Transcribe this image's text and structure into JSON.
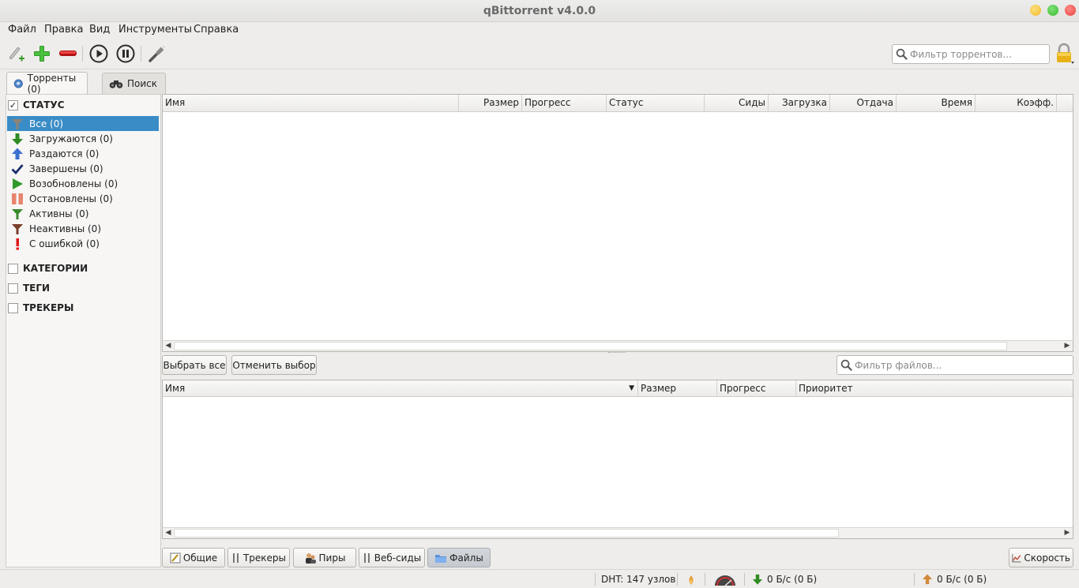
{
  "window": {
    "title": "qBittorrent v4.0.0"
  },
  "menu": [
    "Файл",
    "Правка",
    "Вид",
    "Инструменты",
    "Справка"
  ],
  "toolbar": {
    "icons": [
      "add-link-icon",
      "add-torrent-icon",
      "remove-icon",
      "resume-icon",
      "pause-icon",
      "settings-icon",
      "lock-icon"
    ],
    "search_placeholder": "Фильтр торрентов..."
  },
  "tabs": [
    {
      "label": "Торренты (0)",
      "icon": "torrents-icon",
      "active": true
    },
    {
      "label": "Поиск",
      "icon": "binoculars-icon",
      "active": false
    }
  ],
  "sidebar": {
    "status_title": "СТАТУС",
    "status_checked": true,
    "items": [
      {
        "label": "Все (0)",
        "icon": "filter-icon",
        "selected": true
      },
      {
        "label": "Загружаются (0)",
        "icon": "download-arrow-icon"
      },
      {
        "label": "Раздаются (0)",
        "icon": "upload-arrow-icon"
      },
      {
        "label": "Завершены (0)",
        "icon": "checkmark-icon"
      },
      {
        "label": "Возобновлены (0)",
        "icon": "play-icon"
      },
      {
        "label": "Остановлены (0)",
        "icon": "pause-bars-icon"
      },
      {
        "label": "Активны (0)",
        "icon": "active-filter-icon"
      },
      {
        "label": "Неактивны (0)",
        "icon": "inactive-filter-icon"
      },
      {
        "label": "С ошибкой (0)",
        "icon": "error-icon"
      }
    ],
    "sections": [
      "КАТЕГОРИИ",
      "ТЕГИ",
      "ТРЕКЕРЫ"
    ]
  },
  "torrent_table": {
    "columns": [
      "Имя",
      "Размер",
      "Прогресс",
      "Статус",
      "Сиды",
      "Загрузка",
      "Отдача",
      "Время",
      "Коэфф."
    ]
  },
  "files": {
    "select_all": "Выбрать все",
    "deselect": "Отменить выбор",
    "search_placeholder": "Фильтр файлов...",
    "columns": [
      "Имя",
      "Размер",
      "Прогресс",
      "Приоритет"
    ]
  },
  "bottom_tabs": [
    {
      "label": "Общие",
      "icon": "general-icon"
    },
    {
      "label": "Трекеры",
      "icon": "trackers-icon"
    },
    {
      "label": "Пиры",
      "icon": "peers-icon"
    },
    {
      "label": "Веб-сиды",
      "icon": "webseeds-icon"
    },
    {
      "label": "Файлы",
      "icon": "folder-icon",
      "active": true
    }
  ],
  "speed_button": "Скорость",
  "status": {
    "dht": "DHT: 147 узлов",
    "download": "0 Б/с (0 Б)",
    "upload": "0 Б/с (0 Б)"
  }
}
